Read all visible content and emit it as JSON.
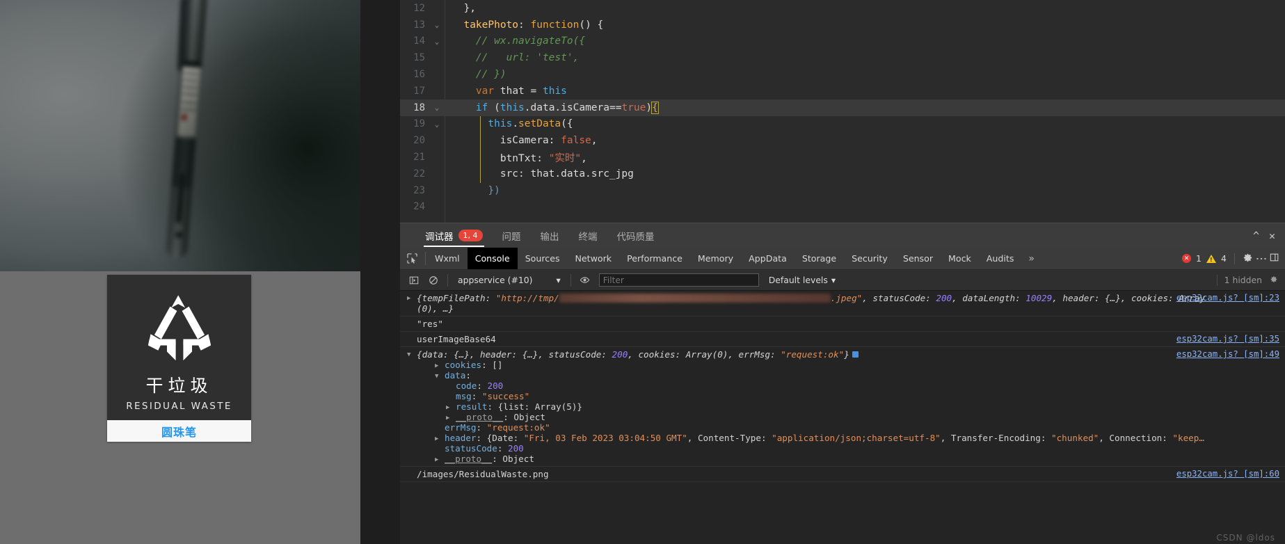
{
  "simulator": {
    "preview_alt": "camera-preview-photo-of-ballpoint-pen",
    "card": {
      "icon": "residual-waste-recycle-icon",
      "title_cn": "干垃圾",
      "title_en": "RESIDUAL WASTE",
      "item_label": "圆珠笔"
    }
  },
  "editor": {
    "lines": [
      {
        "num": "12",
        "fold": "",
        "active": false,
        "tokens": [
          {
            "t": "  ",
            "c": "k-plain"
          },
          {
            "t": "},",
            "c": "k-white"
          }
        ]
      },
      {
        "num": "13",
        "fold": "v",
        "active": false,
        "tokens": [
          {
            "t": "  ",
            "c": "k-plain"
          },
          {
            "t": "takePhoto",
            "c": "k-fn"
          },
          {
            "t": ": ",
            "c": "k-white"
          },
          {
            "t": "function",
            "c": "k-orange"
          },
          {
            "t": "() {",
            "c": "k-white"
          }
        ]
      },
      {
        "num": "14",
        "fold": "v",
        "active": false,
        "tokens": [
          {
            "t": "    // wx.navigateTo({",
            "c": "k-com"
          }
        ]
      },
      {
        "num": "15",
        "fold": "",
        "active": false,
        "tokens": [
          {
            "t": "    //   url: 'test',",
            "c": "k-com"
          }
        ]
      },
      {
        "num": "16",
        "fold": "",
        "active": false,
        "tokens": [
          {
            "t": "    // })",
            "c": "k-com"
          }
        ]
      },
      {
        "num": "17",
        "fold": "",
        "active": false,
        "tokens": [
          {
            "t": "    ",
            "c": "k-plain"
          },
          {
            "t": "var",
            "c": "k-key"
          },
          {
            "t": " that ",
            "c": "k-white"
          },
          {
            "t": "= ",
            "c": "k-white"
          },
          {
            "t": "this",
            "c": "k-cyan"
          }
        ]
      },
      {
        "num": "18",
        "fold": "v",
        "active": true,
        "tokens": [
          {
            "t": "    ",
            "c": "k-plain"
          },
          {
            "t": "if",
            "c": "k-cyan"
          },
          {
            "t": " (",
            "c": "k-white"
          },
          {
            "t": "this",
            "c": "k-cyan"
          },
          {
            "t": ".data.isCamera==",
            "c": "k-white"
          },
          {
            "t": "true",
            "c": "k-red"
          },
          {
            "t": ")",
            "c": "k-white"
          },
          {
            "t": "{",
            "c": "k-orange"
          }
        ]
      },
      {
        "num": "19",
        "fold": "v",
        "active": false,
        "tokens": [
          {
            "t": "      ",
            "c": "k-plain"
          },
          {
            "t": "this",
            "c": "k-cyan"
          },
          {
            "t": ".",
            "c": "k-white"
          },
          {
            "t": "setData",
            "c": "k-orange"
          },
          {
            "t": "({",
            "c": "k-white"
          }
        ]
      },
      {
        "num": "20",
        "fold": "",
        "active": false,
        "tokens": [
          {
            "t": "        isCamera: ",
            "c": "k-white"
          },
          {
            "t": "false",
            "c": "k-red"
          },
          {
            "t": ",",
            "c": "k-white"
          }
        ]
      },
      {
        "num": "21",
        "fold": "",
        "active": false,
        "tokens": [
          {
            "t": "        btnTxt: ",
            "c": "k-white"
          },
          {
            "t": "\"实时\"",
            "c": "k-str-cn"
          },
          {
            "t": ",",
            "c": "k-white"
          }
        ]
      },
      {
        "num": "22",
        "fold": "",
        "active": false,
        "tokens": [
          {
            "t": "        src: that.data.src_jpg",
            "c": "k-white"
          }
        ]
      },
      {
        "num": "23",
        "fold": "",
        "active": false,
        "tokens": [
          {
            "t": "      ",
            "c": "k-plain"
          },
          {
            "t": "})",
            "c": "k-blue"
          }
        ]
      },
      {
        "num": "24",
        "fold": "",
        "active": false,
        "tokens": [
          {
            "t": "",
            "c": "k-plain"
          }
        ]
      }
    ]
  },
  "debugger_bar": {
    "tabs": [
      {
        "label": "调试器",
        "badge": "1, 4",
        "active": true
      },
      {
        "label": "问题",
        "badge": "",
        "active": false
      },
      {
        "label": "输出",
        "badge": "",
        "active": false
      },
      {
        "label": "终端",
        "badge": "",
        "active": false
      },
      {
        "label": "代码质量",
        "badge": "",
        "active": false
      }
    ],
    "collapse_icon": "chevron-up-icon",
    "close_icon": "close-icon"
  },
  "devtools": {
    "inspect_icon": "inspect-element-icon",
    "tabs": [
      {
        "label": "Wxml",
        "active": false
      },
      {
        "label": "Console",
        "active": true
      },
      {
        "label": "Sources",
        "active": false
      },
      {
        "label": "Network",
        "active": false
      },
      {
        "label": "Performance",
        "active": false
      },
      {
        "label": "Memory",
        "active": false
      },
      {
        "label": "AppData",
        "active": false
      },
      {
        "label": "Storage",
        "active": false
      },
      {
        "label": "Security",
        "active": false
      },
      {
        "label": "Sensor",
        "active": false
      },
      {
        "label": "Mock",
        "active": false
      },
      {
        "label": "Audits",
        "active": false
      }
    ],
    "more_tabs": "»",
    "error_count": "1",
    "warning_count": "4",
    "settings_icon": "gear-icon",
    "menu_icon": "kebab-menu-icon",
    "dock_icon": "dock-panel-icon"
  },
  "console_toolbar": {
    "sidebar_icon": "console-sidebar-icon",
    "clear_icon": "clear-console-icon",
    "context": "appservice (#10)",
    "context_caret": "▾",
    "eye_icon": "live-expression-eye-icon",
    "filter_placeholder": "Filter",
    "filter_value": "",
    "levels_label": "Default levels",
    "levels_caret": "▾",
    "hidden_label": "1 hidden",
    "settings_icon": "console-settings-gear-icon"
  },
  "console": {
    "entries": [
      {
        "id": "tempfile",
        "toggle": "triangle-right-icon",
        "src": "esp32cam.js? [sm]:23",
        "segments": [
          {
            "t": "{tempFilePath: ",
            "c": "c-plain"
          },
          {
            "t": "\"http://tmp/",
            "c": "c-str"
          },
          {
            "t": "__REDACT__",
            "c": "redact"
          },
          {
            "t": ".jpeg\"",
            "c": "c-str"
          },
          {
            "t": ", statusCode: ",
            "c": "c-plain"
          },
          {
            "t": "200",
            "c": "c-num"
          },
          {
            "t": ", dataLength: ",
            "c": "c-plain"
          },
          {
            "t": "10029",
            "c": "c-num"
          },
          {
            "t": ", header: {…}, cookies: Array",
            "c": "c-plain"
          }
        ],
        "line2": "(0), …}"
      },
      {
        "id": "res",
        "text": "\"res\"",
        "src": ""
      },
      {
        "id": "userimage",
        "text": "userImageBase64",
        "src": "esp32cam.js? [sm]:35"
      },
      {
        "id": "response",
        "toggle": "triangle-down-icon",
        "src": "esp32cam.js? [sm]:49",
        "segments": [
          {
            "t": "{data: {…}, header: {…}, statusCode: ",
            "c": "c-plain"
          },
          {
            "t": "200",
            "c": "c-num"
          },
          {
            "t": ", cookies: Array(0), errMsg: ",
            "c": "c-plain"
          },
          {
            "t": "\"request:ok\"",
            "c": "c-str"
          },
          {
            "t": "}",
            "c": "c-plain"
          }
        ],
        "children": [
          {
            "indent": 1,
            "toggle": "triangle-right-icon",
            "key": "cookies",
            "val": "[]",
            "valClass": "c-plain"
          },
          {
            "indent": 1,
            "toggle": "triangle-down-icon",
            "key": "data",
            "val": "",
            "valClass": "c-plain"
          },
          {
            "indent": 2,
            "toggle": "",
            "key": "code",
            "val": "200",
            "valClass": "c-num"
          },
          {
            "indent": 2,
            "toggle": "",
            "key": "msg",
            "val": "\"success\"",
            "valClass": "c-str"
          },
          {
            "indent": 2,
            "toggle": "triangle-right-icon",
            "key": "result",
            "val": "{list: Array(5)}",
            "valClass": "c-plain"
          },
          {
            "indent": 2,
            "toggle": "triangle-right-icon",
            "key": "__proto__",
            "val": "Object",
            "valClass": "c-plain",
            "proto": true
          },
          {
            "indent": 1,
            "toggle": "",
            "key": "errMsg",
            "val": "\"request:ok\"",
            "valClass": "c-str"
          },
          {
            "indent": 1,
            "toggle": "triangle-right-icon",
            "key": "header",
            "val": "__HEADER__",
            "valClass": "c-plain"
          },
          {
            "indent": 1,
            "toggle": "",
            "key": "statusCode",
            "val": "200",
            "valClass": "c-num"
          },
          {
            "indent": 1,
            "toggle": "triangle-right-icon",
            "key": "__proto__",
            "val": "Object",
            "valClass": "c-plain",
            "proto": true
          }
        ],
        "header_segments": [
          {
            "t": "{Date: ",
            "c": "c-plain"
          },
          {
            "t": "\"Fri, 03 Feb 2023 03:04:50 GMT\"",
            "c": "c-str"
          },
          {
            "t": ", Content-Type: ",
            "c": "c-plain"
          },
          {
            "t": "\"application/json;charset=utf-8\"",
            "c": "c-str"
          },
          {
            "t": ", Transfer-Encoding: ",
            "c": "c-plain"
          },
          {
            "t": "\"chunked\"",
            "c": "c-str"
          },
          {
            "t": ", Connection: ",
            "c": "c-plain"
          },
          {
            "t": "\"keep…",
            "c": "c-str"
          }
        ]
      },
      {
        "id": "imgpath",
        "text": "/images/ResidualWaste.png",
        "src": "esp32cam.js? [sm]:60"
      }
    ],
    "watermark": "CSDN @ldos"
  },
  "colors": {
    "accent_blue": "#2196f3",
    "error_red": "#e53935",
    "warning_yellow": "#f5c518",
    "link_blue": "#8ab4f8",
    "string_orange": "#e08f5a",
    "number_purple": "#9980ff"
  }
}
